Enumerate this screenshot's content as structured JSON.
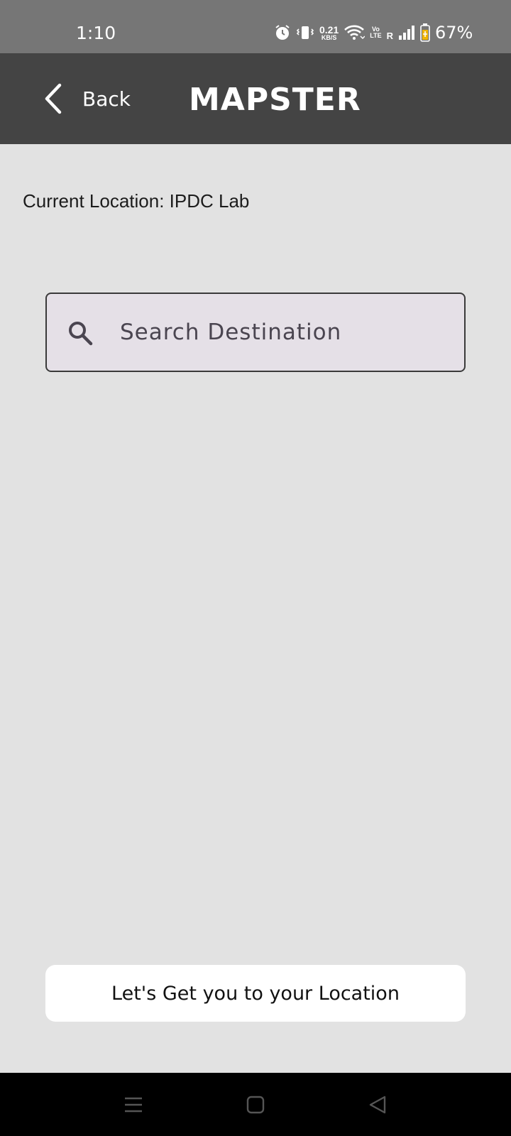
{
  "status_bar": {
    "time": "1:10",
    "net_speed_value": "0.21",
    "net_speed_unit": "KB/S",
    "volte_top": "Vo",
    "volte_bottom": "LTE",
    "roaming": "R",
    "battery_percent": "67%",
    "icons": [
      "alarm-icon",
      "vibrate-icon",
      "wifi-icon",
      "signal-icon",
      "battery-icon"
    ]
  },
  "app_bar": {
    "back_label": "Back",
    "title": "MAPSTER"
  },
  "main": {
    "current_location": "Current Location: IPDC Lab",
    "search": {
      "placeholder": "Search Destination",
      "value": ""
    },
    "cta_label": "Let's Get you to your Location"
  },
  "nav_bar": {
    "buttons": [
      "recents",
      "home",
      "back"
    ]
  },
  "colors": {
    "status_bar_bg": "#767676",
    "app_bar_bg": "#444444",
    "page_bg": "#e2e2e2",
    "search_bg": "#e5e0e7",
    "button_bg": "#ffffff"
  }
}
